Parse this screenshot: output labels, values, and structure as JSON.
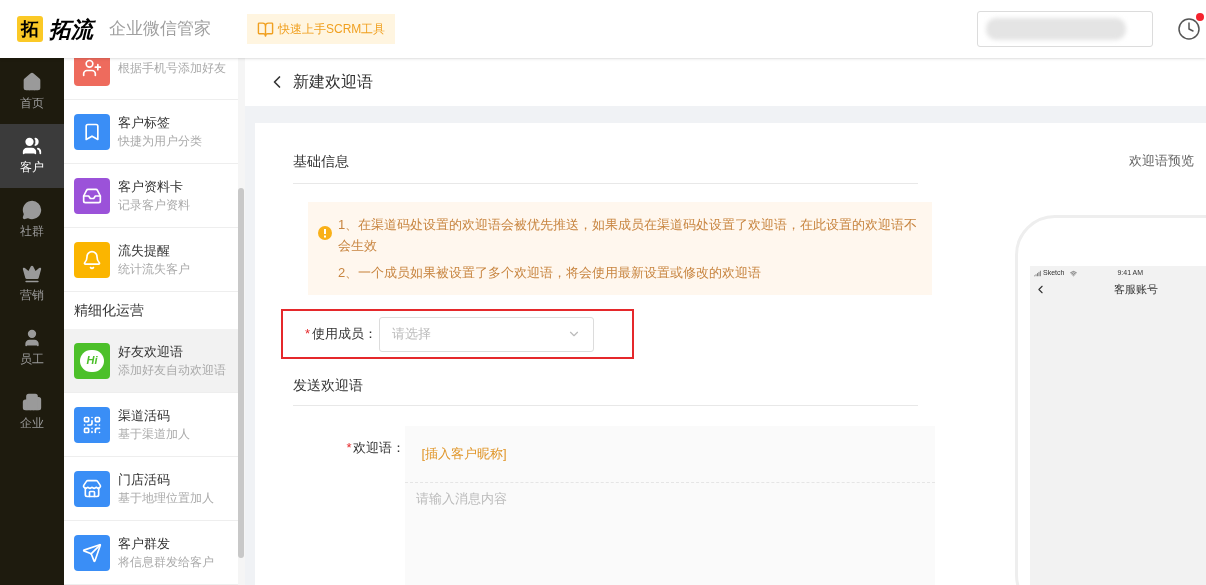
{
  "header": {
    "logo_mark": "拓",
    "brand": "拓流",
    "product": "企业微信管家",
    "guide_button": "快速上手SCRM工具",
    "notice_unread": true
  },
  "rail": [
    {
      "label": "首页",
      "selected": false
    },
    {
      "label": "客户",
      "selected": true
    },
    {
      "label": "社群",
      "selected": false
    },
    {
      "label": "营销",
      "selected": false
    },
    {
      "label": "员工",
      "selected": false
    },
    {
      "label": "企业",
      "selected": false
    }
  ],
  "submenu": [
    {
      "kind": "item",
      "subtitle": "根据手机号添加好友",
      "color": "#ee6b5d",
      "selected": false
    },
    {
      "kind": "item",
      "title": "客户标签",
      "subtitle": "快捷为用户分类",
      "color": "#3a8ef6",
      "selected": false
    },
    {
      "kind": "item",
      "title": "客户资料卡",
      "subtitle": "记录客户资料",
      "color": "#9b52d9",
      "selected": false
    },
    {
      "kind": "item",
      "title": "流失提醒",
      "subtitle": "统计流失客户",
      "color": "#fbb500",
      "selected": false
    },
    {
      "kind": "group",
      "title": "精细化运营"
    },
    {
      "kind": "item",
      "title": "好友欢迎语",
      "subtitle": "添加好友自动欢迎语",
      "color": "#4cc02a",
      "icon_text": "Hi",
      "selected": true
    },
    {
      "kind": "item",
      "title": "渠道活码",
      "subtitle": "基于渠道加人",
      "color": "#3a8ef6",
      "selected": false
    },
    {
      "kind": "item",
      "title": "门店活码",
      "subtitle": "基于地理位置加人",
      "color": "#3a8ef6",
      "selected": false
    },
    {
      "kind": "item",
      "title": "客户群发",
      "subtitle": "将信息群发给客户",
      "color": "#3a8ef6",
      "selected": false
    }
  ],
  "page": {
    "title": "新建欢迎语",
    "section_basic": "基础信息",
    "notice": [
      "1、在渠道码处设置的欢迎语会被优先推送，如果成员在渠道码处设置了欢迎语，在此设置的欢迎语不会生效",
      "2、一个成员如果被设置了多个欢迎语，将会使用最新设置或修改的欢迎语"
    ],
    "member_field": {
      "label": "使用成员：",
      "required_mark": "*",
      "placeholder": "请选择",
      "highlighted": true
    },
    "section_send": "发送欢迎语",
    "welcome_field": {
      "label": "欢迎语：",
      "required_mark": "*",
      "insert_link": "[插入客户昵称]",
      "placeholder": "请输入消息内容"
    },
    "preview": {
      "title": "欢迎语预览",
      "carrier": "Sketch",
      "time": "9:41 AM",
      "chat_title": "客服账号"
    }
  }
}
